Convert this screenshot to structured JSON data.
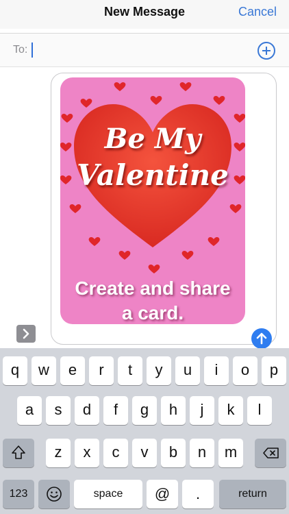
{
  "header": {
    "title": "New Message",
    "cancel_label": "Cancel"
  },
  "to_field": {
    "label": "To:",
    "value": ""
  },
  "card": {
    "line_script_1": "Be My",
    "line_script_2": "Valentine",
    "caption_line_1": "Create and share",
    "caption_line_2": "a card."
  },
  "keyboard": {
    "row1": [
      "q",
      "w",
      "e",
      "r",
      "t",
      "y",
      "u",
      "i",
      "o",
      "p"
    ],
    "row2": [
      "a",
      "s",
      "d",
      "f",
      "g",
      "h",
      "j",
      "k",
      "l"
    ],
    "row3": [
      "z",
      "x",
      "c",
      "v",
      "b",
      "n",
      "m"
    ],
    "numbers_label": "123",
    "space_label": "space",
    "at_label": "@",
    "dot_label": ".",
    "return_label": "return"
  },
  "colors": {
    "accent": "#3a78d6",
    "card_pink": "#ee84c6",
    "heart_red": "#e8392f"
  }
}
